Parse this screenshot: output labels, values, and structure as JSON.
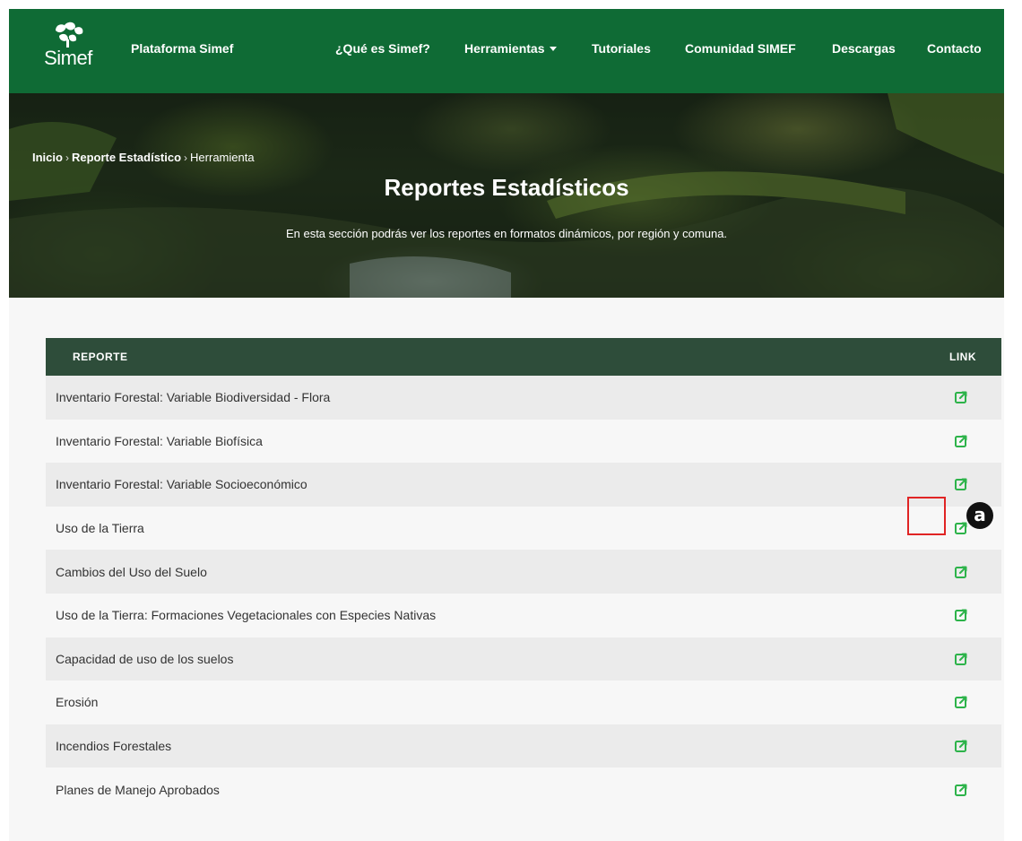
{
  "navbar": {
    "logo_text": "Simef",
    "brand": "Plataforma Simef",
    "items": [
      {
        "label": "¿Qué es Simef?"
      },
      {
        "label": "Herramientas",
        "has_dropdown": true
      },
      {
        "label": "Tutoriales"
      },
      {
        "label": "Comunidad SIMEF"
      },
      {
        "label": "Descargas"
      },
      {
        "label": "Contacto"
      }
    ],
    "color": "#0f6b35"
  },
  "breadcrumb": {
    "items": [
      "Inicio",
      "Reporte Estadístico",
      "Herramienta"
    ],
    "separator": "›"
  },
  "hero": {
    "title": "Reportes Estadísticos",
    "subtitle": "En esta sección podrás ver los reportes en formatos dinámicos, por región y comuna."
  },
  "table": {
    "header_color": "#2e4d3a",
    "columns": [
      "REPORTE",
      "LINK"
    ],
    "rows": [
      {
        "name": "Inventario Forestal: Variable Biodiversidad - Flora",
        "link_icon": "external-link-icon"
      },
      {
        "name": "Inventario Forestal: Variable Biofísica",
        "link_icon": "external-link-icon"
      },
      {
        "name": "Inventario Forestal: Variable Socioeconómico",
        "link_icon": "external-link-icon"
      },
      {
        "name": "Uso de la Tierra",
        "link_icon": "external-link-icon"
      },
      {
        "name": "Cambios del Uso del Suelo",
        "link_icon": "external-link-icon"
      },
      {
        "name": "Uso de la Tierra: Formaciones Vegetacionales con Especies Nativas",
        "link_icon": "external-link-icon"
      },
      {
        "name": "Capacidad de uso de los suelos",
        "link_icon": "external-link-icon"
      },
      {
        "name": "Erosión",
        "link_icon": "external-link-icon"
      },
      {
        "name": "Incendios Forestales",
        "link_icon": "external-link-icon"
      },
      {
        "name": "Planes de Manejo Aprobados",
        "link_icon": "external-link-icon"
      }
    ],
    "link_icon_color": "#2db34a"
  },
  "callout": {
    "label": "a",
    "border_color": "#e02424"
  }
}
